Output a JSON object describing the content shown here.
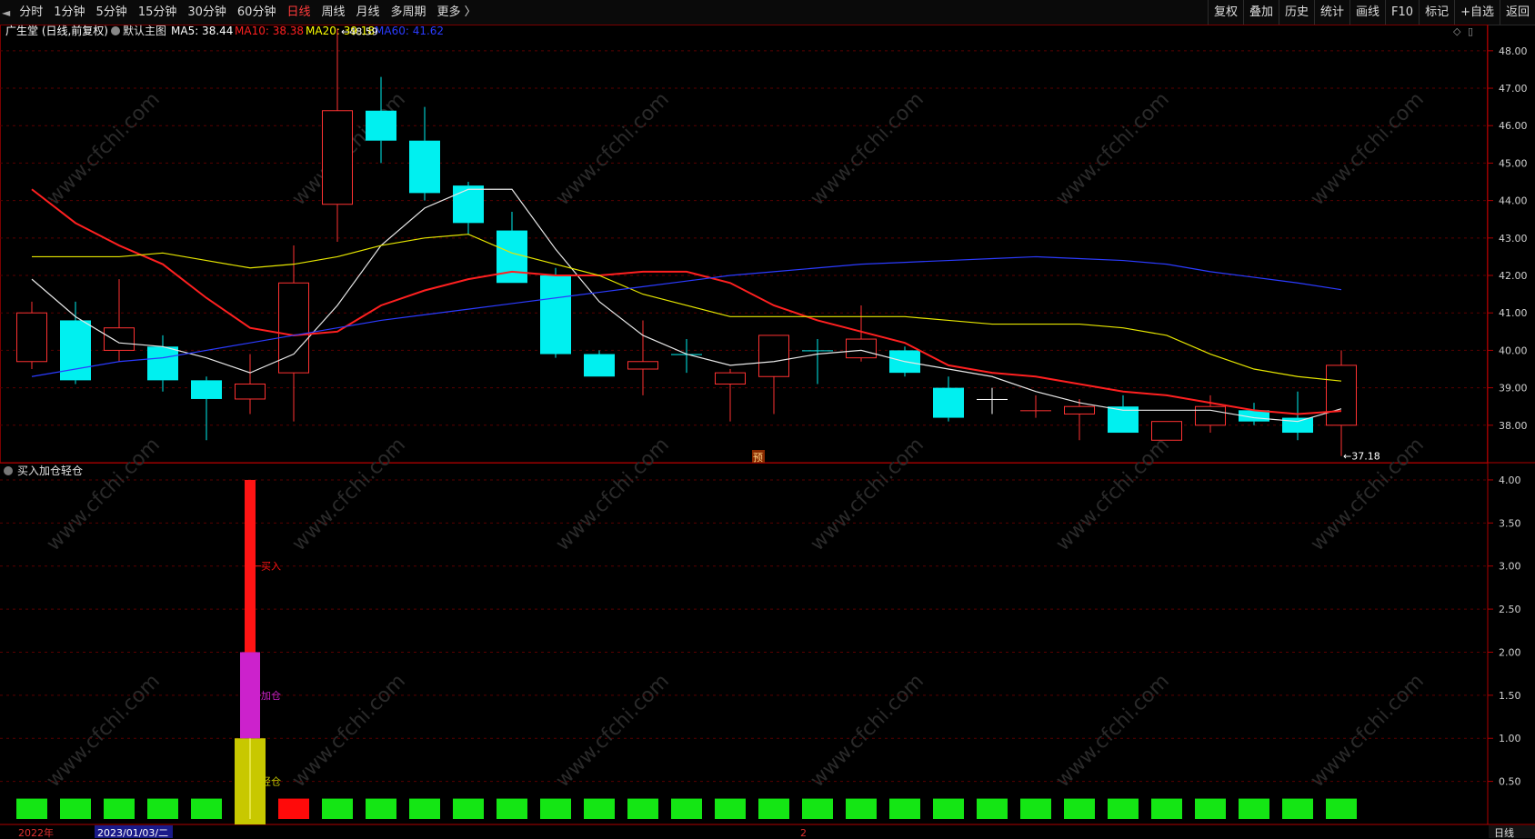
{
  "toolbar": {
    "periods": [
      "分时",
      "1分钟",
      "5分钟",
      "15分钟",
      "30分钟",
      "60分钟",
      "日线",
      "周线",
      "月线",
      "多周期",
      "更多 〉"
    ],
    "active_period": "日线",
    "actions": [
      "复权",
      "叠加",
      "历史",
      "统计",
      "画线",
      "F10",
      "标记",
      "+自选",
      "返回"
    ]
  },
  "main_header": {
    "stock": "广生堂 (日线,前复权)",
    "template": "默认主图",
    "ma": [
      {
        "label": "MA5: 38.44",
        "color": "#ffffff"
      },
      {
        "label": "MA10: 38.38",
        "color": "#ff2020"
      },
      {
        "label": "MA20: 39.18",
        "color": "#ffff00"
      },
      {
        "label": "MA60: 41.62",
        "color": "#2b3bff"
      }
    ]
  },
  "indicator_header": {
    "title": "买入加仓轻仓"
  },
  "watermark": "www.cfchi.com",
  "marker": "预",
  "bottom": {
    "year_label": "2022年",
    "cursor_date": "2023/01/03/二",
    "mid_label": "2",
    "period_tab": "日线"
  },
  "chart_data": [
    {
      "type": "candlestick",
      "title": "广生堂 (日线,前复权)",
      "ylim": [
        37.0,
        48.7
      ],
      "yticks": [
        38.0,
        39.0,
        40.0,
        41.0,
        42.0,
        43.0,
        44.0,
        45.0,
        46.0,
        47.0,
        48.0
      ],
      "max_label": "48.59",
      "min_label": "37.18",
      "candles": [
        {
          "o": 39.7,
          "c": 41.0,
          "h": 41.3,
          "l": 39.5
        },
        {
          "o": 40.8,
          "c": 39.2,
          "h": 41.3,
          "l": 39.1
        },
        {
          "o": 40.0,
          "c": 40.6,
          "h": 41.9,
          "l": 39.7
        },
        {
          "o": 40.1,
          "c": 39.2,
          "h": 40.4,
          "l": 38.9
        },
        {
          "o": 39.2,
          "c": 38.7,
          "h": 39.3,
          "l": 37.6
        },
        {
          "o": 38.7,
          "c": 39.1,
          "h": 39.9,
          "l": 38.3
        },
        {
          "o": 39.4,
          "c": 41.8,
          "h": 42.8,
          "l": 38.1
        },
        {
          "o": 43.9,
          "c": 46.4,
          "h": 48.59,
          "l": 42.9
        },
        {
          "o": 46.4,
          "c": 45.6,
          "h": 47.3,
          "l": 45.0
        },
        {
          "o": 45.6,
          "c": 44.2,
          "h": 46.5,
          "l": 44.0
        },
        {
          "o": 44.4,
          "c": 43.4,
          "h": 44.5,
          "l": 43.1
        },
        {
          "o": 43.2,
          "c": 41.8,
          "h": 43.7,
          "l": 41.8
        },
        {
          "o": 42.0,
          "c": 39.9,
          "h": 42.2,
          "l": 39.8
        },
        {
          "o": 39.9,
          "c": 39.3,
          "h": 40.0,
          "l": 39.3
        },
        {
          "o": 39.5,
          "c": 39.7,
          "h": 40.8,
          "l": 38.8
        },
        {
          "o": 39.9,
          "c": 39.9,
          "h": 40.3,
          "l": 39.4
        },
        {
          "o": 39.1,
          "c": 39.4,
          "h": 39.5,
          "l": 38.1
        },
        {
          "o": 39.3,
          "c": 40.4,
          "h": 40.4,
          "l": 38.3
        },
        {
          "o": 40.0,
          "c": 40.0,
          "h": 40.3,
          "l": 39.1
        },
        {
          "o": 39.8,
          "c": 40.3,
          "h": 41.2,
          "l": 39.7
        },
        {
          "o": 40.0,
          "c": 39.4,
          "h": 40.1,
          "l": 39.3
        },
        {
          "o": 39.0,
          "c": 38.2,
          "h": 39.3,
          "l": 38.1
        },
        {
          "o": 38.7,
          "c": 38.7,
          "h": 39.0,
          "l": 38.3
        },
        {
          "o": 38.4,
          "c": 38.4,
          "h": 38.8,
          "l": 38.2
        },
        {
          "o": 38.3,
          "c": 38.5,
          "h": 38.7,
          "l": 37.6
        },
        {
          "o": 38.5,
          "c": 37.8,
          "h": 38.8,
          "l": 37.8
        },
        {
          "o": 37.6,
          "c": 38.1,
          "h": 38.1,
          "l": 37.6
        },
        {
          "o": 38.0,
          "c": 38.5,
          "h": 38.8,
          "l": 37.8
        },
        {
          "o": 38.4,
          "c": 38.1,
          "h": 38.6,
          "l": 38.0
        },
        {
          "o": 38.2,
          "c": 37.8,
          "h": 38.9,
          "l": 37.6
        },
        {
          "o": 38.0,
          "c": 39.6,
          "h": 40.0,
          "l": 37.18
        }
      ],
      "series": [
        {
          "name": "MA5",
          "color": "#e8e8e8",
          "values": [
            41.9,
            40.9,
            40.2,
            40.1,
            39.8,
            39.4,
            39.9,
            41.2,
            42.8,
            43.8,
            44.3,
            44.3,
            42.7,
            41.3,
            40.4,
            39.9,
            39.6,
            39.7,
            39.9,
            40.0,
            39.7,
            39.5,
            39.3,
            38.9,
            38.6,
            38.4,
            38.4,
            38.4,
            38.2,
            38.1,
            38.44
          ]
        },
        {
          "name": "MA10",
          "color": "#ff2020",
          "values": [
            44.3,
            43.4,
            42.8,
            42.3,
            41.4,
            40.6,
            40.4,
            40.5,
            41.2,
            41.6,
            41.9,
            42.1,
            42.0,
            42.0,
            42.1,
            42.1,
            41.8,
            41.2,
            40.8,
            40.5,
            40.2,
            39.6,
            39.4,
            39.3,
            39.1,
            38.9,
            38.8,
            38.6,
            38.4,
            38.3,
            38.38
          ]
        },
        {
          "name": "MA20",
          "color": "#e6e600",
          "values": [
            42.5,
            42.5,
            42.5,
            42.6,
            42.4,
            42.2,
            42.3,
            42.5,
            42.8,
            43.0,
            43.1,
            42.6,
            42.3,
            42.0,
            41.5,
            41.2,
            40.9,
            40.9,
            40.9,
            40.9,
            40.9,
            40.8,
            40.7,
            40.7,
            40.7,
            40.6,
            40.4,
            39.9,
            39.5,
            39.3,
            39.18
          ]
        },
        {
          "name": "MA60",
          "color": "#2b3bff",
          "start": 0,
          "values": [
            39.3,
            39.5,
            39.7,
            39.8,
            40.0,
            40.2,
            40.4,
            40.6,
            40.8,
            40.95,
            41.1,
            41.25,
            41.4,
            41.55,
            41.7,
            41.85,
            42.0,
            42.1,
            42.2,
            42.3,
            42.35,
            42.4,
            42.45,
            42.5,
            42.45,
            42.4,
            42.3,
            42.1,
            41.95,
            41.8,
            41.62
          ]
        }
      ]
    },
    {
      "type": "bar",
      "title": "买入加仓轻仓",
      "ylim": [
        0,
        4.2
      ],
      "yticks": [
        0.5,
        1.0,
        1.5,
        2.0,
        2.5,
        3.0,
        3.5,
        4.0
      ],
      "stack_index": 5,
      "stack": [
        {
          "name": "轻仓",
          "from": 0,
          "to": 1.0,
          "color": "#c8c800"
        },
        {
          "name": "加仓",
          "from": 1.0,
          "to": 2.0,
          "color": "#cc22cc"
        },
        {
          "name": "买入",
          "from": 2.0,
          "to": 4.0,
          "color": "#ff1414"
        }
      ],
      "signal_colors": [
        "green",
        "green",
        "green",
        "green",
        "green",
        "stack",
        "red",
        "green",
        "green",
        "green",
        "green",
        "green",
        "green",
        "green",
        "green",
        "green",
        "green",
        "green",
        "green",
        "green",
        "green",
        "green",
        "green",
        "green",
        "green",
        "green",
        "green",
        "green",
        "green",
        "green",
        "green"
      ],
      "green": "#14e614",
      "red": "#ff0a0a"
    }
  ]
}
